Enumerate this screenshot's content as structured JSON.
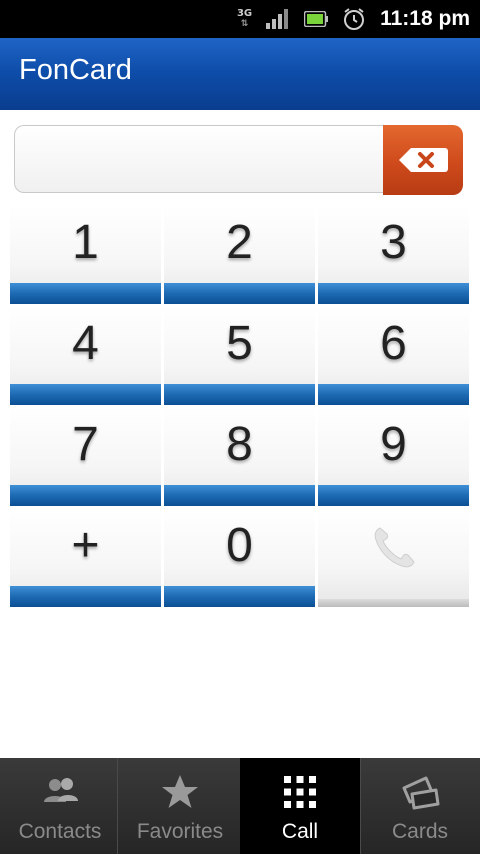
{
  "status": {
    "network": "3G",
    "time": "11:18 pm"
  },
  "app": {
    "title": "FonCard"
  },
  "input": {
    "value": ""
  },
  "keypad": {
    "keys": [
      "1",
      "2",
      "3",
      "4",
      "5",
      "6",
      "7",
      "8",
      "9",
      "+",
      "0"
    ]
  },
  "tabs": [
    {
      "label": "Contacts",
      "icon": "contacts-icon",
      "active": false
    },
    {
      "label": "Favorites",
      "icon": "star-icon",
      "active": false
    },
    {
      "label": "Call",
      "icon": "dialpad-icon",
      "active": true
    },
    {
      "label": "Cards",
      "icon": "cards-icon",
      "active": false
    }
  ]
}
